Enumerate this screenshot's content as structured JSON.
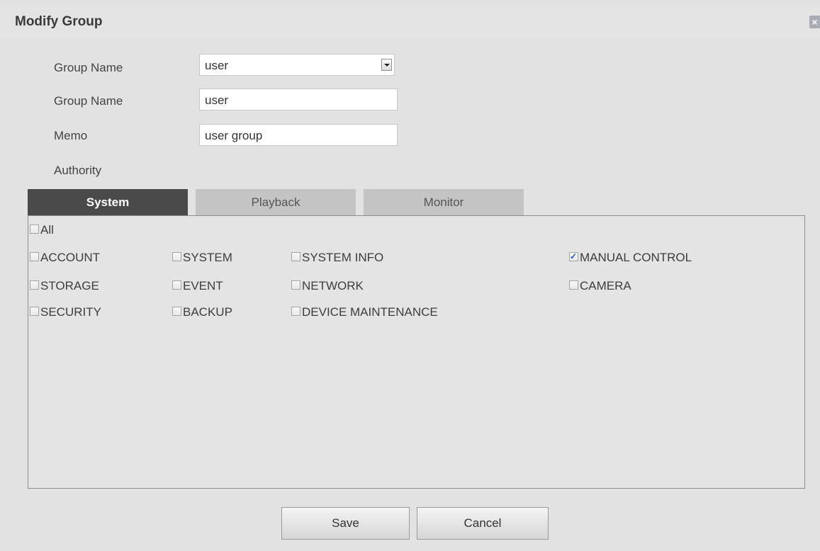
{
  "dialog": {
    "title": "Modify Group",
    "close_icon": "close-icon"
  },
  "form": {
    "group_select_label": "Group Name",
    "group_select_value": "user",
    "group_name_label": "Group Name",
    "group_name_value": "user",
    "memo_label": "Memo",
    "memo_value": "user group",
    "authority_label": "Authority"
  },
  "tabs": [
    {
      "label": "System",
      "active": true
    },
    {
      "label": "Playback",
      "active": false
    },
    {
      "label": "Monitor",
      "active": false
    }
  ],
  "checkboxes": {
    "all": {
      "label": "All",
      "checked": false
    },
    "account": {
      "label": "ACCOUNT",
      "checked": false
    },
    "system": {
      "label": "SYSTEM",
      "checked": false
    },
    "system_info": {
      "label": "SYSTEM INFO",
      "checked": false
    },
    "manual_control": {
      "label": "MANUAL CONTROL",
      "checked": true
    },
    "storage": {
      "label": "STORAGE",
      "checked": false
    },
    "event": {
      "label": "EVENT",
      "checked": false
    },
    "network": {
      "label": "NETWORK",
      "checked": false
    },
    "camera": {
      "label": "CAMERA",
      "checked": false
    },
    "security": {
      "label": "SECURITY",
      "checked": false
    },
    "backup": {
      "label": "BACKUP",
      "checked": false
    },
    "device_maintenance": {
      "label": "DEVICE MAINTENANCE",
      "checked": false
    }
  },
  "buttons": {
    "save": "Save",
    "cancel": "Cancel"
  },
  "colors": {
    "active_tab": "#4a4a4a",
    "inactive_tab": "#c4c4c4",
    "check_mark": "#2a52b6"
  }
}
